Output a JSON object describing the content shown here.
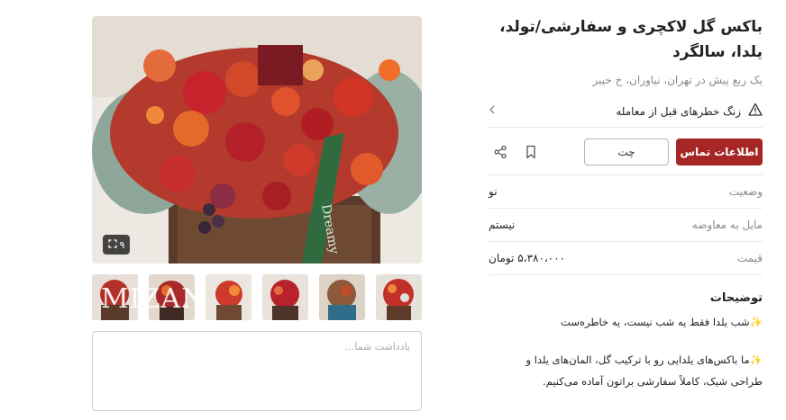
{
  "listing": {
    "title": "باکس گل لاکچری و سفارشی/تولد، یلدا، سالگرد",
    "subtitle": "یک ربع پیش در تهران، نیاوران، خ خیبر"
  },
  "risk": {
    "label": "زنگ خطرهای قبل از معامله"
  },
  "actions": {
    "contact_label": "اطلاعات تماس",
    "chat_label": "چت"
  },
  "specs": [
    {
      "key": "وضعیت",
      "value": "نو"
    },
    {
      "key": "مایل به معاوضه",
      "value": "نیستم"
    },
    {
      "key": "قیمت",
      "value": "۵،۳۸۰،۰۰۰ تومان"
    }
  ],
  "description": {
    "heading": "توضیحات",
    "line1": "✨شب یلدا فقط یه شب نیست، یه خاطره‌ست",
    "line2": "✨ما باکس‌های یلدایی رو با ترکیب گل، المان‌های یلدا و",
    "line3": "طراحی شیک، کاملاً سفارشی براتون آماده می‌کنیم."
  },
  "gallery": {
    "count_label": "۹",
    "watermark": "MIZAN",
    "ribbon_text": "Dreamy"
  },
  "note": {
    "placeholder": "یادداشت شما..."
  },
  "icons": [
    "warning-icon",
    "chevron-left-icon",
    "bookmark-icon",
    "share-icon",
    "gallery-expand-icon"
  ],
  "colors": {
    "primary": "#a62626",
    "muted": "#8a8a8a",
    "border": "#e6e6e6"
  }
}
